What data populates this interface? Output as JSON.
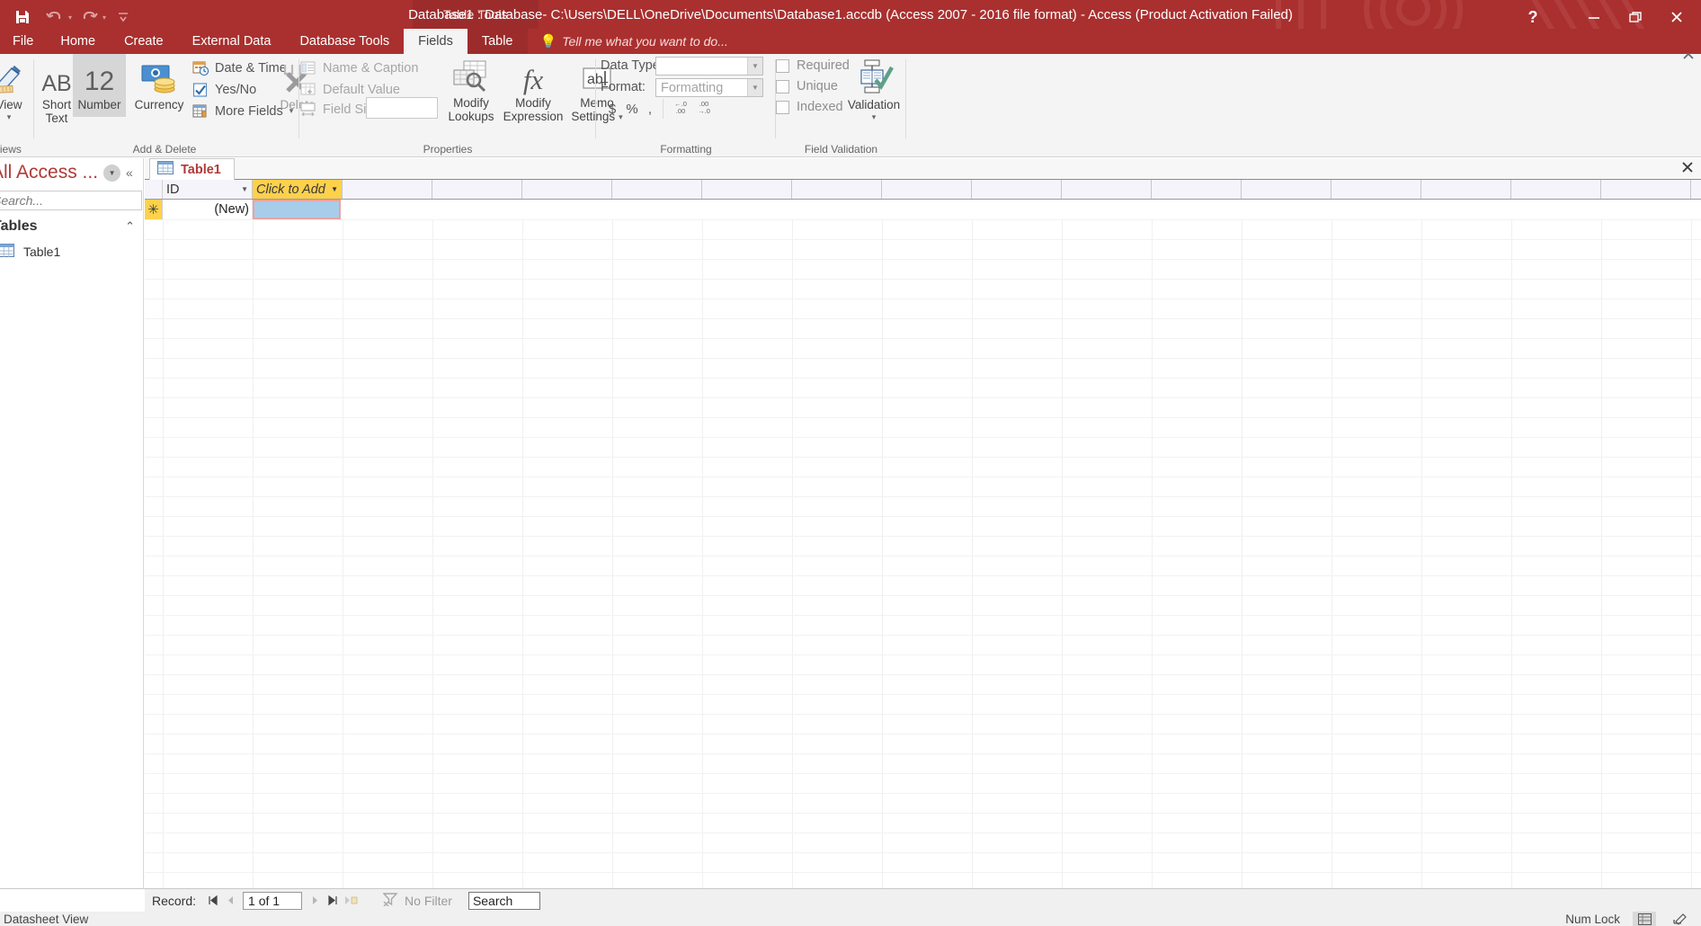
{
  "titlebar": {
    "title": "Database1 : Database- C:\\Users\\DELL\\OneDrive\\Documents\\Database1.accdb (Access 2007 - 2016 file format) - Access (Product Activation Failed)",
    "context_tab_group": "Table Tools",
    "quick_access": [
      {
        "name": "save",
        "icon": "save-icon",
        "glyph": "ὋE"
      },
      {
        "name": "undo",
        "icon": "undo-icon",
        "glyph": "↶"
      },
      {
        "name": "redo",
        "icon": "redo-icon",
        "glyph": "↷"
      },
      {
        "name": "customize",
        "icon": "chevron-down-icon",
        "glyph": "▾"
      }
    ],
    "window_controls": [
      {
        "name": "help",
        "glyph": "?"
      },
      {
        "name": "minimize",
        "glyph": "─"
      },
      {
        "name": "restore",
        "glyph": "❐"
      },
      {
        "name": "close",
        "glyph": "✕"
      }
    ]
  },
  "ribbon": {
    "tabs": [
      {
        "label": "File",
        "active": false,
        "kind": "file"
      },
      {
        "label": "Home",
        "active": false,
        "kind": "normal"
      },
      {
        "label": "Create",
        "active": false,
        "kind": "normal"
      },
      {
        "label": "External Data",
        "active": false,
        "kind": "normal"
      },
      {
        "label": "Database Tools",
        "active": false,
        "kind": "normal"
      },
      {
        "label": "Fields",
        "active": true,
        "kind": "contextual"
      },
      {
        "label": "Table",
        "active": false,
        "kind": "contextual"
      }
    ],
    "tell_me_placeholder": "Tell me what you want to do...",
    "groups": [
      {
        "name": "views",
        "label": "Views"
      },
      {
        "name": "add-delete",
        "label": "Add & Delete"
      },
      {
        "name": "properties",
        "label": "Properties"
      },
      {
        "name": "formatting",
        "label": "Formatting"
      },
      {
        "name": "field-validation",
        "label": "Field Validation"
      }
    ],
    "views": {
      "button_label": "View",
      "icon": "view-datasheet-icon"
    },
    "add_delete": {
      "short_text": {
        "label_line1": "Short",
        "label_line2": "Text",
        "icon": "ab-text-icon",
        "icon_text": "AB"
      },
      "number": {
        "label": "Number",
        "icon": "number-icon",
        "icon_text": "12"
      },
      "currency": {
        "label": "Currency",
        "icon": "currency-icon"
      },
      "date_time": {
        "label": "Date & Time",
        "icon": "calendar-clock-icon"
      },
      "yes_no": {
        "label": "Yes/No",
        "icon": "checkbox-icon"
      },
      "more_fields": {
        "label": "More Fields",
        "icon": "more-fields-icon"
      },
      "delete": {
        "label": "Delete",
        "icon": "delete-column-icon"
      }
    },
    "properties": {
      "name_caption": {
        "label": "Name & Caption",
        "icon": "name-caption-icon"
      },
      "default_value": {
        "label": "Default Value",
        "icon": "default-value-icon"
      },
      "field_size": {
        "label": "Field Size",
        "icon": "field-size-icon",
        "value": ""
      },
      "modify_lookups": {
        "label_line1": "Modify",
        "label_line2": "Lookups",
        "icon": "modify-lookups-icon"
      },
      "modify_expression": {
        "label_line1": "Modify",
        "label_line2": "Expression",
        "icon": "fx-icon",
        "icon_text": "fx"
      },
      "memo_settings": {
        "label_line1": "Memo",
        "label_line2": "Settings",
        "icon": "memo-icon",
        "icon_text": "ab|"
      }
    },
    "formatting": {
      "data_type_label": "Data Type:",
      "data_type_value": "",
      "format_label": "Format:",
      "format_value": "Formatting",
      "currency_btn": {
        "label": "$",
        "name": "apply-currency-format"
      },
      "percent_btn": {
        "label": "%",
        "name": "apply-percent-format"
      },
      "comma_btn": {
        "label": ",",
        "name": "apply-comma-format"
      },
      "increase_decimal": {
        "name": "increase-decimals",
        "top": "←.0",
        "bottom": ".00"
      },
      "decrease_decimal": {
        "name": "decrease-decimals",
        "top": ".00",
        "bottom": "→.0"
      }
    },
    "field_validation": {
      "required": {
        "label": "Required",
        "checked": false
      },
      "unique": {
        "label": "Unique",
        "checked": false
      },
      "indexed": {
        "label": "Indexed",
        "checked": false
      },
      "validation": {
        "label": "Validation",
        "icon": "validation-icon"
      }
    },
    "collapse_icon": "chevron-up-icon"
  },
  "navpane": {
    "title": "All Access ...",
    "filter_icon": "filter-dropdown-icon",
    "collapse_icon": "double-chevron-left-icon",
    "search_placeholder": "Search...",
    "search_value": "",
    "search_icon": "search-icon",
    "group": {
      "label": "Tables",
      "collapse_icon": "double-chevron-up-icon"
    },
    "items": [
      {
        "label": "Table1",
        "icon": "table-icon"
      }
    ]
  },
  "document": {
    "tabs": [
      {
        "label": "Table1",
        "icon": "table-icon",
        "active": true
      }
    ],
    "close_icon": "close-icon"
  },
  "datasheet": {
    "columns": [
      {
        "label": "ID",
        "name": "column-id",
        "has_dropdown": true
      },
      {
        "label": "Click to Add",
        "name": "column-click-to-add",
        "has_dropdown": true
      }
    ],
    "rows": [
      {
        "selector": "new-record-asterisk",
        "id_value": "(New)",
        "new_cell_value": ""
      }
    ]
  },
  "statusbar": {
    "record_label": "Record:",
    "record_position": "1 of 1",
    "nav_first": "first-record",
    "nav_prev": "previous-record",
    "nav_next": "next-record",
    "nav_last": "last-record",
    "nav_new": "new-record",
    "filter_label": "No Filter",
    "filter_icon": "filter-icon",
    "search_placeholder": "Search",
    "search_value": "Search",
    "view_label": "Datasheet View",
    "num_lock": "Num Lock",
    "view_buttons": [
      {
        "name": "datasheet-view-button",
        "icon": "datasheet-view-icon",
        "active": true
      },
      {
        "name": "design-view-button",
        "icon": "design-view-icon",
        "active": false
      }
    ]
  },
  "colors": {
    "accent": "#a9302f",
    "contextual_tab": "#9c2c2b",
    "header_yellow": "#fdd14c",
    "selected_cell": "#a8cdea",
    "selected_cell_border": "#e9a3a0",
    "ribbon_bg": "#f4f4f4",
    "nav_title": "#b03a36"
  }
}
